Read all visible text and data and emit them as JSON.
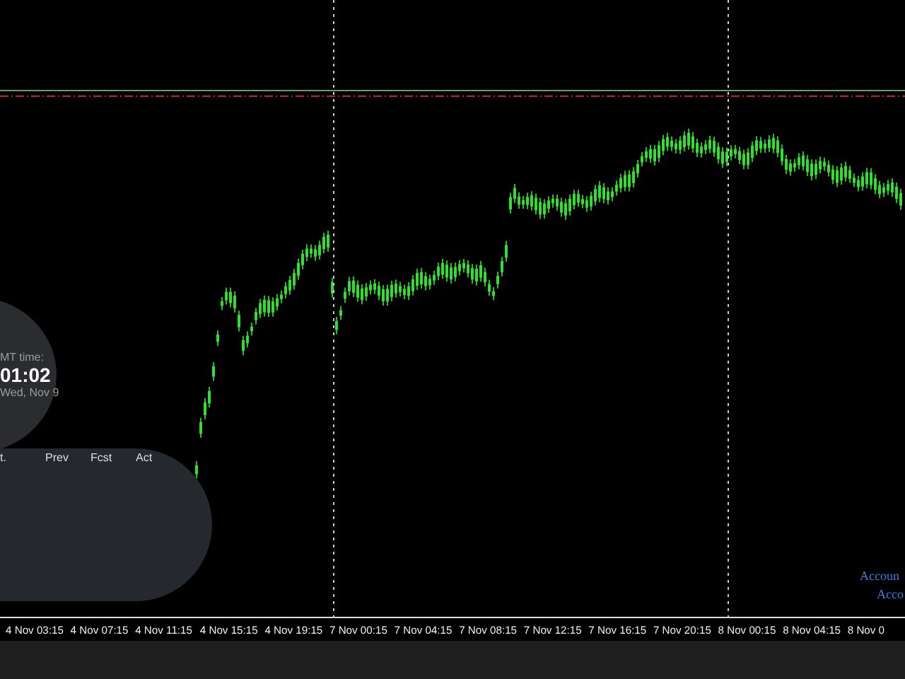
{
  "clock": {
    "label": "MT time:",
    "time": "01:02",
    "date": "Wed, Nov 9"
  },
  "calendar": {
    "columns": [
      "t.",
      "Prev",
      "Fcst",
      "Act"
    ]
  },
  "account_labels": [
    "Accoun",
    "Acco"
  ],
  "x_axis": {
    "labels": [
      "4 Nov 03:15",
      "4 Nov 07:15",
      "4 Nov 11:15",
      "4 Nov 15:15",
      "4 Nov 19:15",
      "7 Nov 00:15",
      "7 Nov 04:15",
      "7 Nov 08:15",
      "7 Nov 12:15",
      "7 Nov 16:15",
      "7 Nov 20:15",
      "8 Nov 00:15",
      "8 Nov 04:15",
      "8 Nov 0"
    ]
  }
}
